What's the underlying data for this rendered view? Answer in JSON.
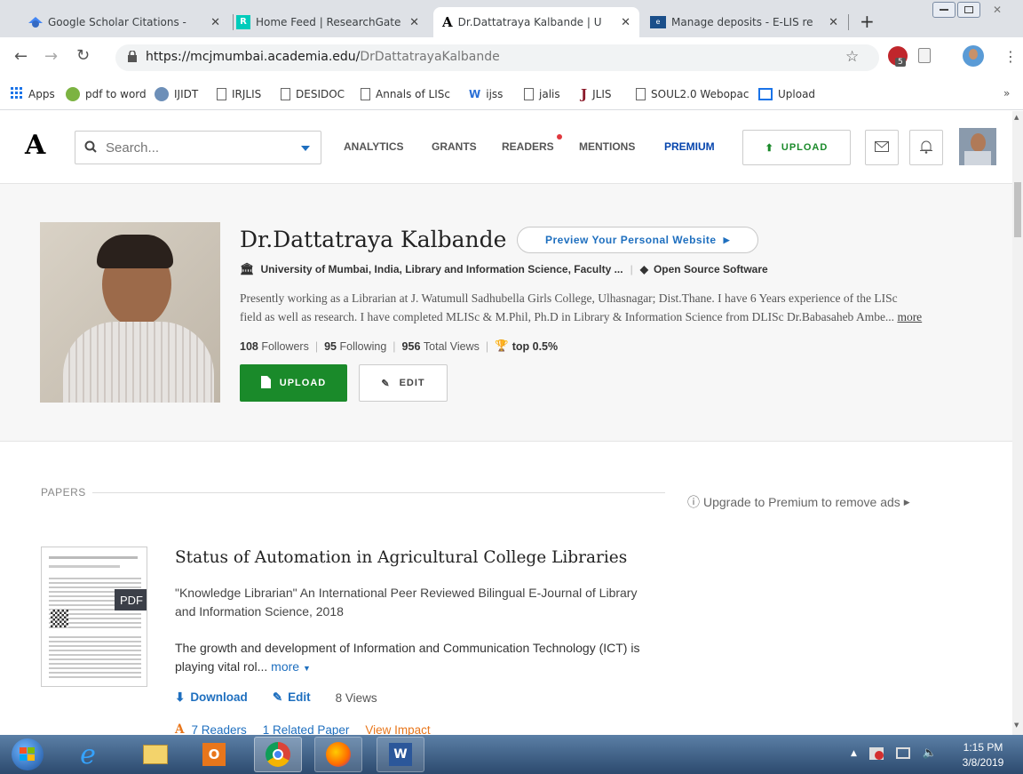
{
  "browser": {
    "tabs": [
      {
        "title": "Google Scholar Citations - ",
        "icon": "google-scholar-icon"
      },
      {
        "title": "Home Feed | ResearchGate",
        "icon": "researchgate-icon"
      },
      {
        "title": "Dr.Dattatraya Kalbande | U",
        "icon": "academia-icon"
      },
      {
        "title": "Manage deposits - E-LIS re",
        "icon": "elis-icon"
      }
    ],
    "url_domain": "https://mcjmumbai.academia.edu/",
    "url_path": "DrDattatrayaKalbande",
    "extension_badge": "5",
    "bookmarks": [
      "Apps",
      "pdf to word",
      "IJIDT",
      "IRJLIS",
      "DESIDOC",
      "Annals of LISc",
      "ijss",
      "jalis",
      "JLIS",
      "SOUL2.0 Webopac",
      "Upload"
    ]
  },
  "header": {
    "logo": "A",
    "search_placeholder": "Search...",
    "nav": [
      "ANALYTICS",
      "GRANTS",
      "READERS",
      "MENTIONS",
      "PREMIUM"
    ],
    "upload_label": "UPLOAD"
  },
  "profile": {
    "name": "Dr.Dattatraya Kalbande",
    "preview_label": "Preview Your Personal Website",
    "affiliation": "University of Mumbai, India, Library and Information Science, Faculty ...",
    "interest": "Open Source Software",
    "bio_line1": "Presently working as a Librarian at J. Watumull Sadhubella Girls College, Ulhasnagar; Dist.Thane. I have 6 Years experience of the LISc",
    "bio_line2": "field as well as research. I have completed MLISc & M.Phil, Ph.D in Library & Information Science from DLISc Dr.Babasaheb Ambe...",
    "bio_more": "more",
    "followers_count": "108",
    "followers_label": "Followers",
    "following_count": "95",
    "following_label": "Following",
    "views_count": "956",
    "views_label": "Total Views",
    "top_label": "top 0.5%",
    "upload_label": "UPLOAD",
    "edit_label": "EDIT"
  },
  "papers": {
    "section_label": "PAPERS",
    "upgrade_label": "Upgrade to Premium to remove ads",
    "items": [
      {
        "title": "Status of Automation in Agricultural College Libraries",
        "journal_line1": "\"Knowledge Librarian\" An International Peer Reviewed Bilingual E-Journal of Library",
        "journal_line2": "and Information Science, 2018",
        "abstract_line1": "The growth and development of Information and Communication Technology (ICT) is",
        "abstract_line2": "playing vital rol...",
        "more_label": "more",
        "pdf_label": "PDF",
        "download_label": "Download",
        "edit_label": "Edit",
        "views": "8 Views",
        "readers": "7 Readers",
        "related": "1 Related Paper",
        "impact": "View Impact"
      }
    ]
  },
  "taskbar": {
    "time": "1:15 PM",
    "date": "3/8/2019",
    "apps": [
      "windows-start-icon",
      "internet-explorer-icon",
      "file-explorer-icon",
      "outlook-icon",
      "chrome-icon",
      "firefox-icon",
      "word-icon"
    ]
  },
  "colors": {
    "accent_green": "#1a8a2a",
    "link_blue": "#1e6fbf",
    "premium_blue": "#0645ad",
    "impact_orange": "#e8761b"
  }
}
